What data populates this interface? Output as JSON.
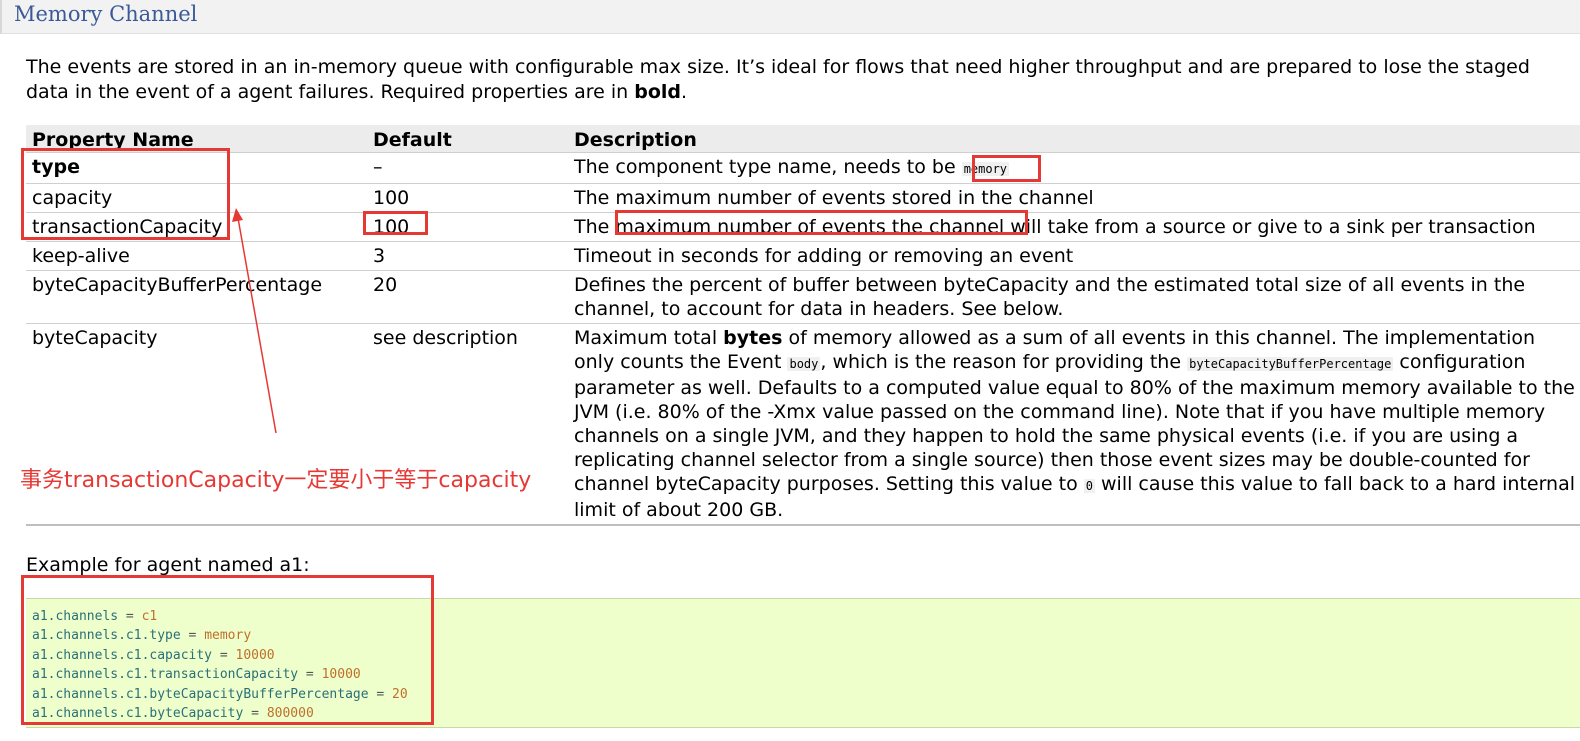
{
  "page": {
    "title": "Memory Channel",
    "intro": {
      "text1": "The events are stored in an in-memory queue with configurable max size. It’s ideal for flows that need higher throughput and are prepared to lose the staged data in the event of a agent failures. Required properties are in ",
      "bold": "bold",
      "text2": "."
    }
  },
  "table": {
    "headers": [
      "Property Name",
      "Default",
      "Description"
    ],
    "rows": [
      {
        "name": "type",
        "default": "–",
        "desc_a": "The component type name, needs to be ",
        "code": "memory"
      },
      {
        "name": "capacity",
        "default": "100",
        "desc": "The maximum number of events stored in the channel"
      },
      {
        "name": "transactionCapacity",
        "default": "100",
        "desc_a": "The ",
        "desc_b": "maximum number of events the channel",
        "desc_c": " will take from a source or give to a sink per transaction"
      },
      {
        "name": "keep-alive",
        "default": "3",
        "desc": "Timeout in seconds for adding or removing an event"
      },
      {
        "name": "byteCapacityBufferPercentage",
        "default": "20",
        "desc": "Defines the percent of buffer between byteCapacity and the estimated total size of all events in the channel, to account for data in headers. See below."
      },
      {
        "name": "byteCapacity",
        "default": "see description",
        "desc_a": "Maximum total ",
        "desc_bold": "bytes",
        "desc_b": " of memory allowed as a sum of all events in this channel. The implementation only counts the Event ",
        "code1": "body",
        "desc_c": ", which is the reason for providing the ",
        "code2": "byteCapacityBufferPercentage",
        "desc_d": " configuration parameter as well. Defaults to a computed value equal to 80% of the maximum memory available to the JVM (i.e. 80% of the -Xmx value passed on the command line). Note that if you have multiple memory channels on a single JVM, and they happen to hold the same physical events (i.e. if you are using a replicating channel selector from a single source) then those event sizes may be double-counted for channel byteCapacity purposes. Setting this value to ",
        "code3": "0",
        "desc_e": " will cause this value to fall back to a hard internal limit of about 200 GB."
      }
    ]
  },
  "annotation": "事务transactionCapacity一定要小于等于capacity",
  "example": {
    "label": "Example for agent named a1:",
    "lines": [
      {
        "key": "a1.channels",
        "op": " = ",
        "val": "c1"
      },
      {
        "key": "a1.channels.c1.type",
        "op": " = ",
        "val": "memory"
      },
      {
        "key": "a1.channels.c1.capacity",
        "op": " = ",
        "val": "10000"
      },
      {
        "key": "a1.channels.c1.transactionCapacity",
        "op": " = ",
        "val": "10000"
      },
      {
        "key": "a1.channels.c1.byteCapacityBufferPercentage",
        "op": " = ",
        "val": "20"
      },
      {
        "key": "a1.channels.c1.byteCapacity",
        "op": " = ",
        "val": "800000"
      }
    ]
  },
  "colors": {
    "annotation_red": "#e53935",
    "code_bg": "#eeffcc",
    "title_blue": "#3b5998"
  }
}
